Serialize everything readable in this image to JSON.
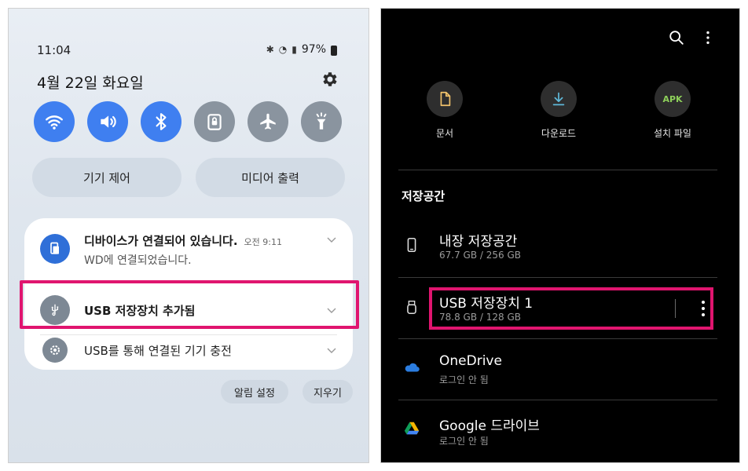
{
  "left": {
    "status": {
      "time": "11:04",
      "battery": "97%"
    },
    "date": "4월 22일 화요일",
    "pills": {
      "device_control": "기기 제어",
      "media_output": "미디어 출력"
    },
    "notifications": [
      {
        "title": "디바이스가 연결되어 있습니다.",
        "time": "오전 9:11",
        "subtitle": "WD에 연결되었습니다."
      },
      {
        "title": "USB 저장장치 추가됨"
      },
      {
        "title": "USB를 통해 연결된 기기 충전"
      }
    ],
    "buttons": {
      "alert_settings": "알림 설정",
      "clear": "지우기"
    }
  },
  "right": {
    "categories": [
      {
        "label": "문서",
        "icon": "document-icon"
      },
      {
        "label": "다운로드",
        "icon": "download-icon"
      },
      {
        "label": "설치 파일",
        "icon": "apk-icon",
        "badge": "APK"
      }
    ],
    "section_title": "저장공간",
    "storage": [
      {
        "name": "내장 저장공간",
        "detail": "67.7 GB / 256 GB"
      },
      {
        "name": "USB 저장장치 1",
        "detail": "78.8 GB / 128 GB"
      },
      {
        "name": "OneDrive",
        "detail": "로그인 안 됨"
      },
      {
        "name": "Google 드라이브",
        "detail": "로그인 안 됨"
      }
    ]
  },
  "colors": {
    "accent_blue": "#3f7ff0",
    "highlight": "#e0156f",
    "apk_green": "#8dcf5a"
  }
}
